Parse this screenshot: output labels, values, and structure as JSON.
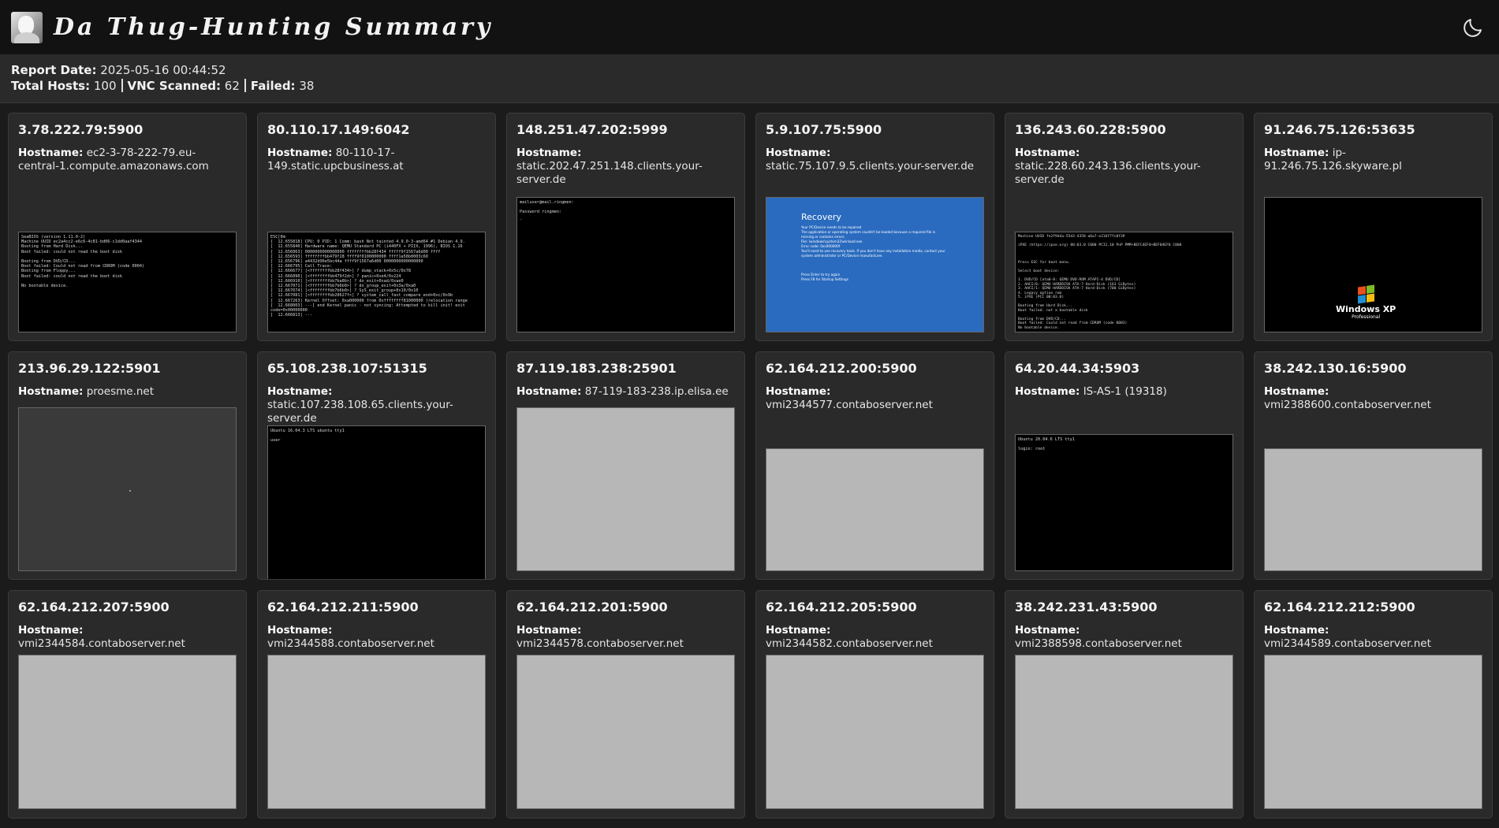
{
  "header": {
    "title": "Da Thug-Hunting Summary",
    "theme_icon": "moon-icon"
  },
  "summary": {
    "report_date_label": "Report Date:",
    "report_date": "2025-05-16 00:44:52",
    "total_hosts_label": "Total Hosts:",
    "total_hosts": "100",
    "vnc_scanned_label": "VNC Scanned:",
    "vnc_scanned": "62",
    "failed_label": "Failed:",
    "failed": "38"
  },
  "hostname_label": "Hostname:",
  "hosts": [
    {
      "address": "3.78.222.79:5900",
      "hostname": "ec2-3-78-222-79.eu-central-1.compute.amazonaws.com",
      "screen_text": "SeaBIOS (version 1.11.0-2)\nMachine UUID ec2a4cc2-e6c6-4c81-bd06-c1dd0aaf4344\nBooting from Hard Disk...\nBoot failed: could not read the boot disk\n\nBooting from DVD/CD...\nBoot failed: Could not read from CDROM (code 0004)\nBooting from Floppy...\nBoot failed: could not read the boot disk\n\nNo bootable device."
    },
    {
      "address": "80.110.17.149:6042",
      "hostname": "80-110-17-149.static.upcbusiness.at",
      "screen_text": "ESC[0m\n[  12.655818] CPU: 0 PID: 1 Comm: bash Not tainted 4.9.0-3-amd64 #1 Debian 4.9.\n[  12.655840] Hardware name: QEMU Standard PC (i440FX + PIIX, 1996), BIOS 1.16\n[  12.656063] 0000000000000000 ffffffffbb28f434 fffff9f1567a6d00 ffff\n[  12.656593] ffffffffbb479f28 ffff9f0100000000 ffff1a58b0003c60\n[  12.656796] a4432d96e5bc44a ffff9f1567a6d00 0000000000000000\n[  12.666795] Call Trace:\n[  12.666677] [<ffffffffbb28f434>] ? dump_stack+0x5c/0x78\n[  12.666890] [<ffffffffbb479f2d>] ? panic+0xe4/0x224\n[  12.666910] [<ffffffffbb7ba8b>] ? do_exit+0xad/0xae0\n[  12.667071] [<ffffffffbb7b6b0>] ? do_group_exit+0x3a/0xa0\n[  12.667074] [<ffffffffbb7b6b0>] ? SyS_exit_group+0x10/0x10\n[  12.667081] [<ffffffffbb20627f>] ? system_call_fast_compare_end+0xc/0x9b\n[  12.667263] Kernel Offset: 0xa000000 from 0xffffffff81000000 (relocation range\n[  12.668003] ---[ end Kernel panic - not syncing: Attempted to kill init! exit\ncode=0x00000000\n[  12.666813] ---"
    },
    {
      "address": "148.251.47.202:5999",
      "hostname": "static.202.47.251.148.clients.your-server.de",
      "screen_text": "mailuser@mail.ringmen:\n\nPassword ringmen:\n_"
    },
    {
      "address": "5.9.107.75:5900",
      "hostname": "static.75.107.9.5.clients.your-server.de",
      "screen_title": "Recovery",
      "screen_text": "Your PC/Device needs to be repaired\nThe application or operating system couldn't be loaded because a required file is missing or contains errors.\nFile: \\windows\\system32\\winload.exe\nError code: 0xc000000f\nYou'll need to use recovery tools. If you don't have any installation media, contact your system administrator or PC/Device manufacturer.\n\n\n\nPress Enter to try again\nPress F8 for Startup Settings"
    },
    {
      "address": "136.243.60.228:5900",
      "hostname": "static.228.60.243.136.clients.your-server.de",
      "screen_text": "Machine UUID fe2f9d4a-55d3-4358-a6a7-e216f7fc0f39\n\niPXE (https://ipxe.org) 00:03.0 C000 PCI2.10 PnP PMM+BEFC4EF0+BEF04EF0 C000\n\n\n\nPress ESC for boot menu.\n\nSelect boot device:\n\n1. DVD/CD [ata0-0: QEMU DVD-ROM ATAPI-4 DVD/CD]\n2. AHCI/0: QEMU HARDDISK ATA-7 Hard-Disk (163 GiBytes)\n3. AHCI/1: QEMU HARDDISK ATA-7 Hard-Disk (700 GiBytes)\n4. Legacy option rom\n5. iPXE (PCI 00:03.0)\n\nBooting from Hard Disk...\nBoot failed: not a bootable disk\n\nBooting from DVD/CD...\nBoot failed: Could not read from CDROM (code 0003)\nNo bootable device."
    },
    {
      "address": "91.246.75.126:53635",
      "hostname": "ip-91.246.75.126.skyware.pl",
      "screen_text": "Windows XP",
      "screen_subtext": "Professional"
    },
    {
      "address": "213.96.29.122:5901",
      "hostname": "proesme.net"
    },
    {
      "address": "65.108.238.107:51315",
      "hostname": "static.107.238.108.65.clients.your-server.de",
      "screen_text": "Ubuntu 16.04.3 LTS ubuntu tty1\n\nuser"
    },
    {
      "address": "87.119.183.238:25901",
      "hostname": "87-119-183-238.ip.elisa.ee"
    },
    {
      "address": "62.164.212.200:5900",
      "hostname": "vmi2344577.contaboserver.net"
    },
    {
      "address": "64.20.44.34:5903",
      "hostname": "IS-AS-1 (19318)",
      "screen_text": "Ubuntu 20.04.6 LTS tty1\n\nlogin: root"
    },
    {
      "address": "38.242.130.16:5900",
      "hostname": "vmi2388600.contaboserver.net"
    },
    {
      "address": "62.164.212.207:5900",
      "hostname": "vmi2344584.contaboserver.net"
    },
    {
      "address": "62.164.212.211:5900",
      "hostname": "vmi2344588.contaboserver.net"
    },
    {
      "address": "62.164.212.201:5900",
      "hostname": "vmi2344578.contaboserver.net"
    },
    {
      "address": "62.164.212.205:5900",
      "hostname": "vmi2344582.contaboserver.net"
    },
    {
      "address": "38.242.231.43:5900",
      "hostname": "vmi2388598.contaboserver.net"
    },
    {
      "address": "62.164.212.212:5900",
      "hostname": "vmi2344589.contaboserver.net"
    }
  ]
}
